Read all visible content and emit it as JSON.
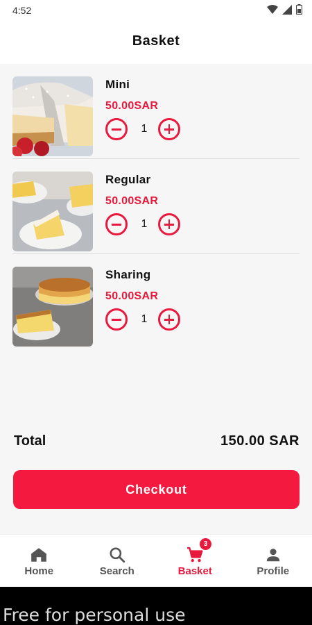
{
  "status_bar": {
    "time": "4:52"
  },
  "header": {
    "title": "Basket"
  },
  "items": [
    {
      "name": "Mini",
      "price": "50.00SAR",
      "quantity": "1"
    },
    {
      "name": "Regular",
      "price": "50.00SAR",
      "quantity": "1"
    },
    {
      "name": "Sharing",
      "price": "50.00SAR",
      "quantity": "1"
    }
  ],
  "summary": {
    "total_label": "Total",
    "total_value": "150.00 SAR"
  },
  "checkout": {
    "label": "Checkout"
  },
  "nav": {
    "items": [
      {
        "label": "Home",
        "icon": "home-icon"
      },
      {
        "label": "Search",
        "icon": "search-icon"
      },
      {
        "label": "Basket",
        "icon": "cart-icon",
        "badge": "3",
        "active": true
      },
      {
        "label": "Profile",
        "icon": "person-icon"
      }
    ]
  },
  "watermark": {
    "text": "Free for personal use"
  },
  "colors": {
    "accent": "#e8193c",
    "button": "#f4193f",
    "background": "#f6f6f6"
  }
}
